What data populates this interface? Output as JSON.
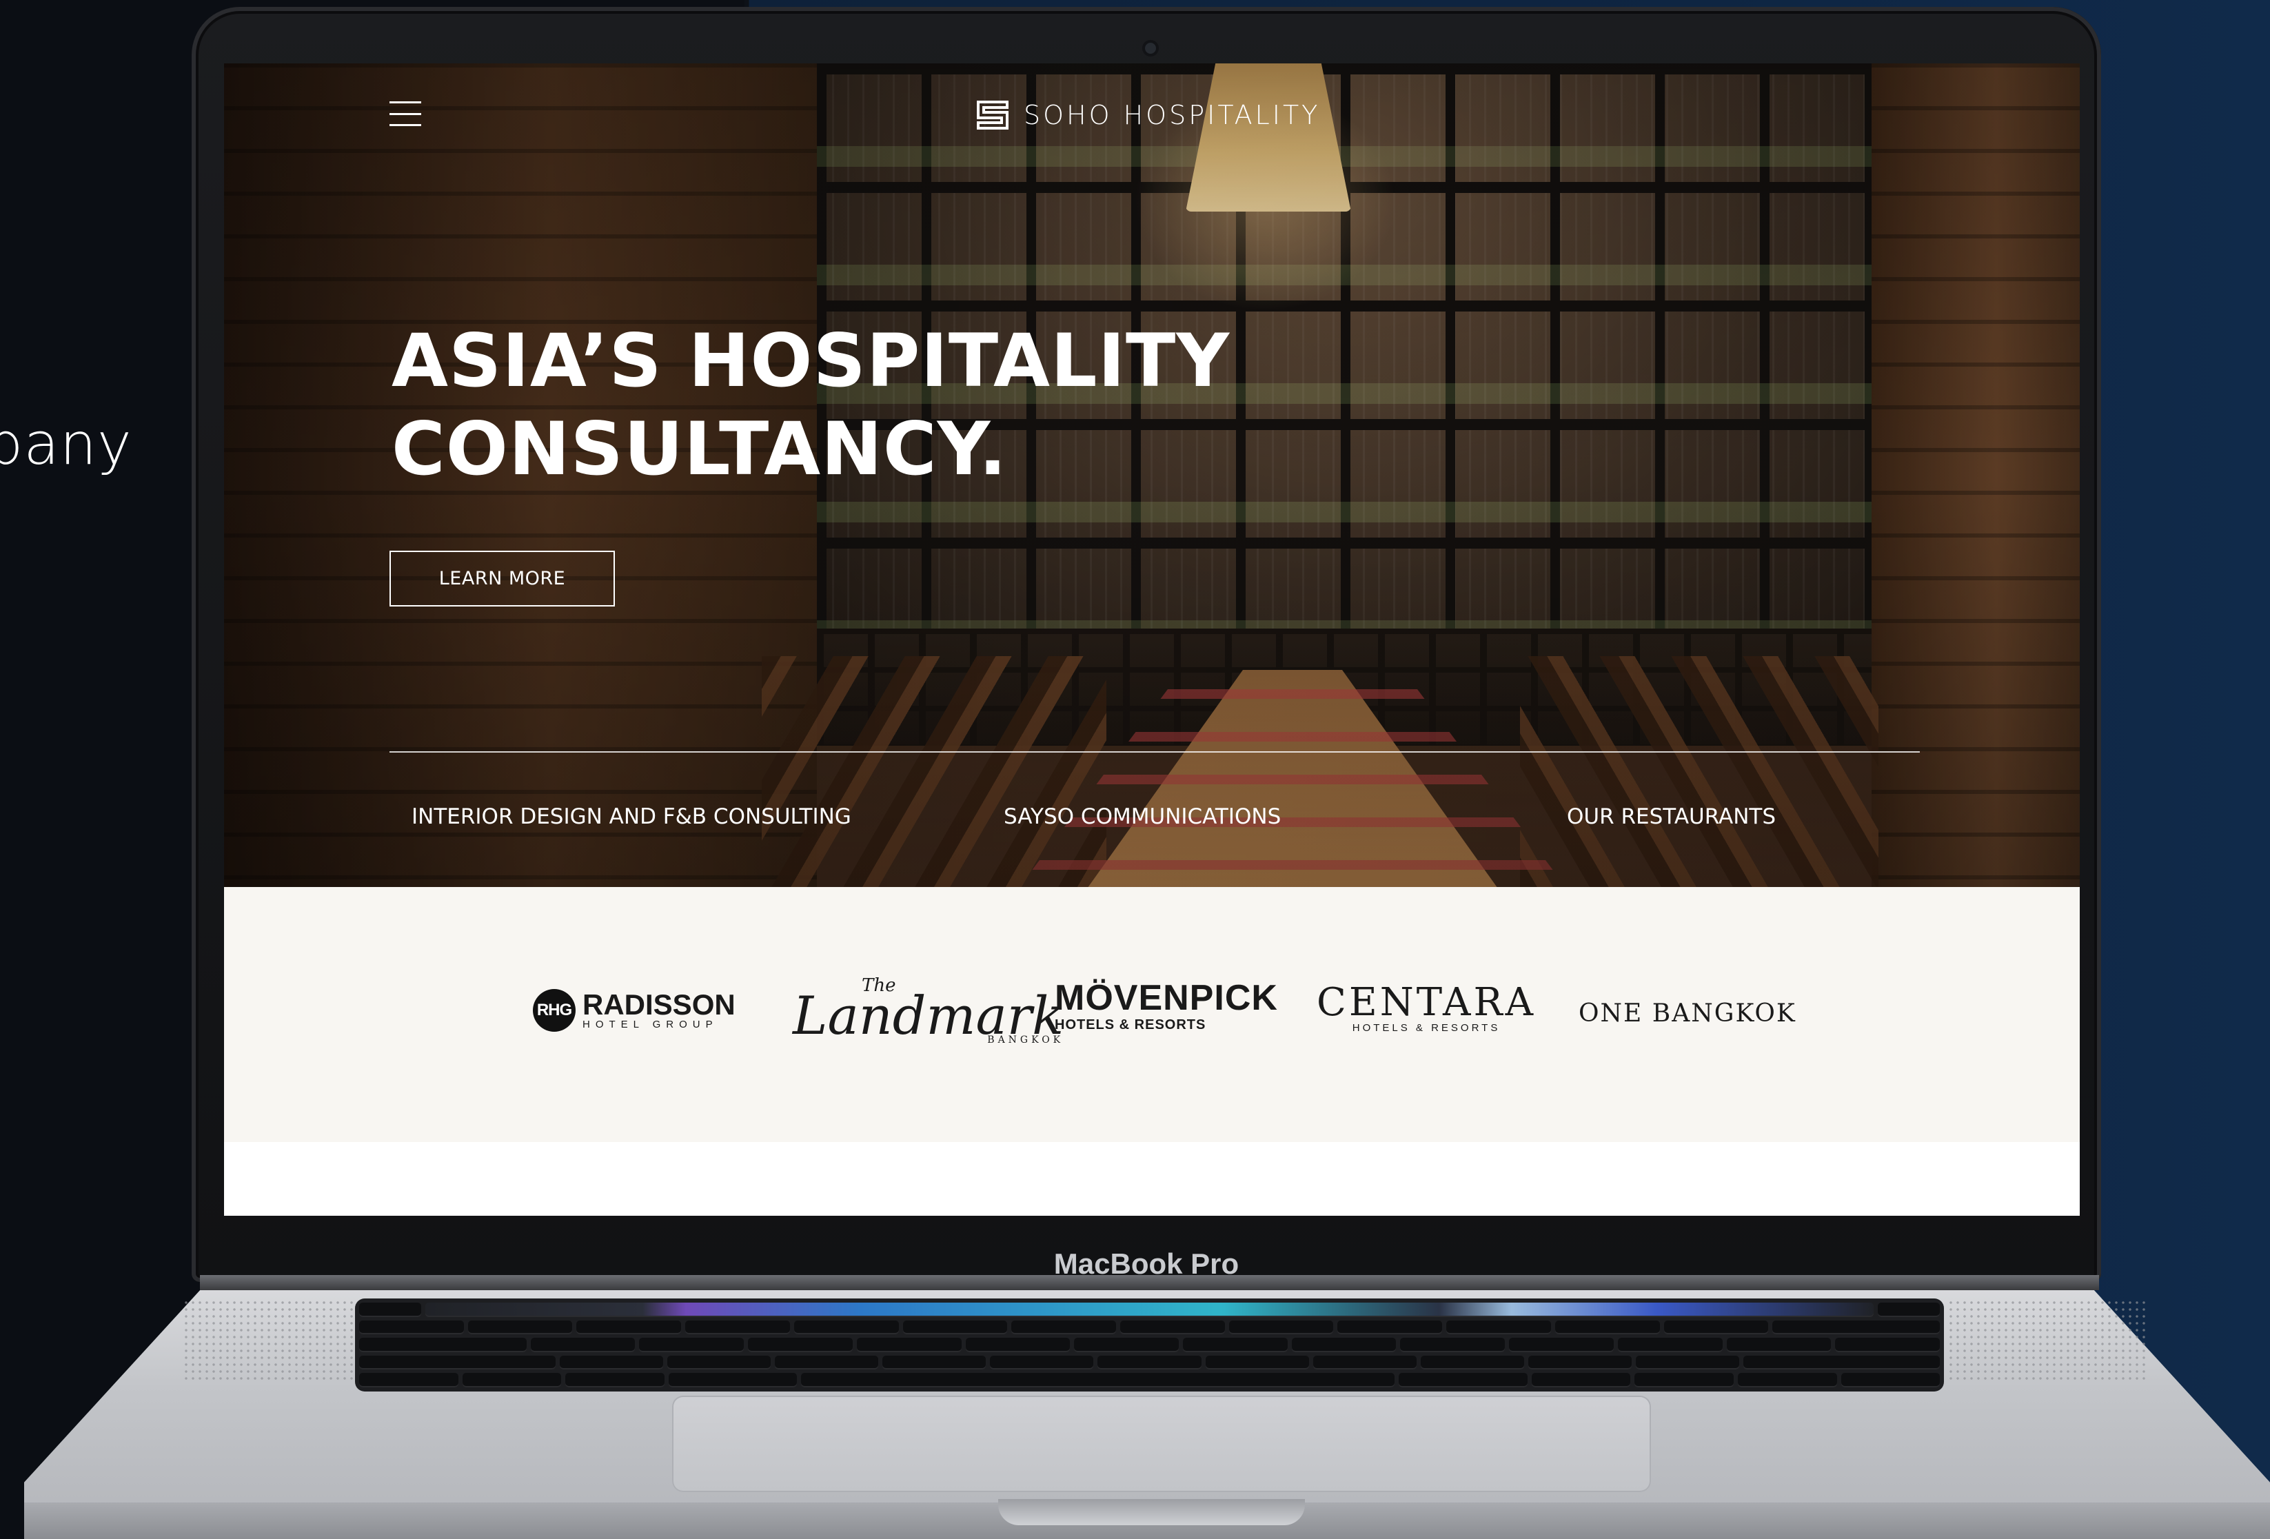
{
  "backdrop": {
    "side_text": "pany"
  },
  "device": {
    "label": "MacBook Pro"
  },
  "site": {
    "brand": "SOHO HOSPITALITY",
    "headline_line1": "ASIA’S HOSPITALITY",
    "headline_line2": "CONSULTANCY.",
    "cta_label": "LEARN MORE",
    "nav": [
      {
        "label": "INTERIOR DESIGN AND F&B CONSULTING"
      },
      {
        "label": "SAYSO COMMUNICATIONS"
      },
      {
        "label": "OUR RESTAURANTS"
      }
    ]
  },
  "partners": {
    "radisson": {
      "badge": "RHG",
      "name": "RADISSON",
      "sub": "HOTEL GROUP"
    },
    "landmark": {
      "pre": "The",
      "name": "Landmark",
      "sub": "BANGKOK"
    },
    "movenpick": {
      "name": "MÖVENPICK",
      "sub": "HOTELS & RESORTS"
    },
    "centara": {
      "name": "CENTARA",
      "sub": "HOTELS & RESORTS"
    },
    "onebangkok": {
      "name": "ONE BANGKOK"
    }
  },
  "colors": {
    "hero_text": "#ffffff",
    "partners_bg": "#f8f6f2",
    "backdrop_blue": "#0e2542"
  }
}
